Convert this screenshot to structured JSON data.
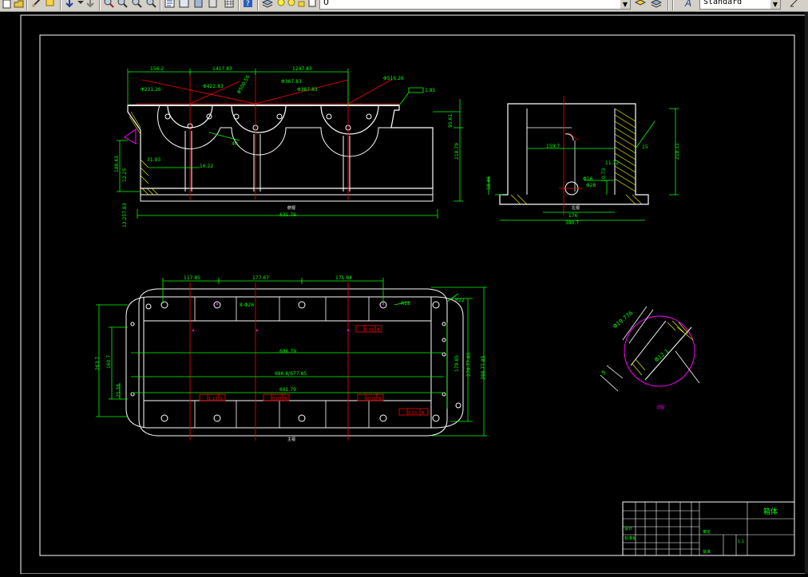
{
  "toolbar": {
    "icons": [
      "new-icon",
      "open-icon",
      "pan-icon",
      "zoom-realtime-icon",
      "zoom-window-icon",
      "zoom-previous-icon",
      "zoom-extents-icon",
      "properties-icon",
      "design-center-icon",
      "tool-palettes-icon",
      "sheet-set-icon",
      "markup-icon",
      "calculator-icon",
      "help-icon",
      "layer-manager-icon",
      "layer-state-icon",
      "layer-properties-icon",
      "style-icon",
      "table-style-icon"
    ],
    "layer_value": "0",
    "style_value": "Standard"
  },
  "drawing": {
    "front_view": {
      "dims_top": [
        "156.2",
        "1417.83",
        "1247.83"
      ],
      "dims_circles": [
        "Φ231.26",
        "Φ422.83",
        "Φ500.56",
        "Φ367.83",
        "Φ387.83",
        "Φ516.26"
      ],
      "tolerance": "1.85",
      "dims_right": [
        "95.61",
        "218.79"
      ],
      "dims_left": [
        "188.63",
        "12.25",
        "12.257.83"
      ],
      "dim_inner": [
        "31.93",
        "16.22",
        "40"
      ],
      "dim_bottom": "631.79",
      "label": "俯视"
    },
    "side_view": {
      "dims": [
        "159.7",
        "11.72",
        "Φ16",
        "Φ28",
        "10.73",
        "18.46",
        "218.11",
        "15",
        "176",
        "380.7"
      ],
      "label": "左视"
    },
    "top_view": {
      "dims_top": [
        "117.85",
        "177.67",
        "171.84"
      ],
      "dims_hole": "8-Φ26",
      "dims_right_top": [
        "R18",
        "R22"
      ],
      "dims_left": [
        "263.7",
        "160.7",
        "25.56"
      ],
      "dims_mid": [
        "686.79",
        "686.8/677.85",
        "661.79"
      ],
      "dims_right": [
        "179.85",
        "279.77.85",
        "388.77.85"
      ],
      "tol_parallel": "0.05",
      "tol_parallel_ref": "B",
      "tol_flat": "0.03",
      "tol_flat_ref": "A",
      "tol_pos": [
        "1.13",
        "0.03",
        "0.03"
      ],
      "tol_pos_ref": [
        "C",
        "B",
        "B"
      ],
      "label": "主视"
    },
    "detail": {
      "dims": [
        "Φ19.776",
        "Φ12.1",
        "5"
      ],
      "label": "详图"
    },
    "title_block": {
      "name": "箱体",
      "cells": [
        "设计",
        "标准化",
        "审定",
        "批准"
      ],
      "scale": "1:1"
    }
  },
  "colors": {
    "toolbar_bg": "#d4d0c8",
    "canvas_bg": "#000000",
    "lines": "#ffffff",
    "dimensions": "#00ff00",
    "centerlines": "#ff0000",
    "hatch": "#ffff00",
    "detail_circle": "#ff00ff"
  }
}
